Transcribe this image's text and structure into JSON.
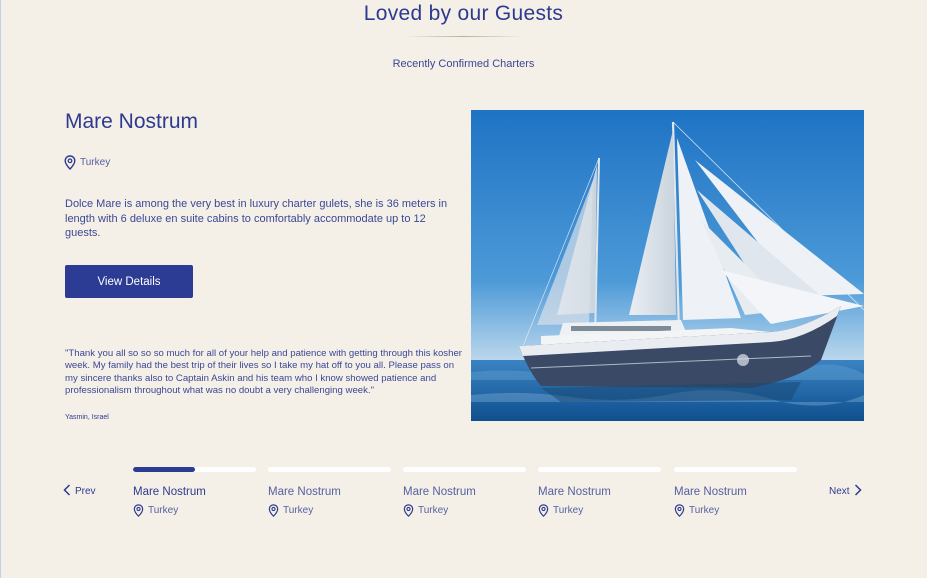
{
  "section": {
    "title": "Loved by our Guests",
    "subtitle": "Recently Confirmed Charters"
  },
  "featured": {
    "name": "Mare Nostrum",
    "location": "Turkey",
    "description": "Dolce Mare is among the very best in luxury charter gulets, she is 36 meters in length with 6 deluxe en suite cabins to comfortably accommodate up to 12 guests.",
    "cta_label": "View Details",
    "quote": "\"Thank you all so so so much for all of your help and patience with getting through this kosher week. My family had the best trip of their lives so I take my hat off to you all. Please pass on my sincere thanks also to Captain Askin and his team who I know showed patience and professionalism throughout what was no doubt a very challenging week.\"",
    "quote_author": "Yasmin, Israel"
  },
  "pager": {
    "prev_label": "Prev",
    "next_label": "Next",
    "active_progress": 0.5,
    "items": [
      {
        "name": "Mare Nostrum",
        "location": "Turkey"
      },
      {
        "name": "Mare Nostrum",
        "location": "Turkey"
      },
      {
        "name": "Mare Nostrum",
        "location": "Turkey"
      },
      {
        "name": "Mare Nostrum",
        "location": "Turkey"
      },
      {
        "name": "Mare Nostrum",
        "location": "Turkey"
      }
    ]
  },
  "colors": {
    "background": "#f4f0e8",
    "accent": "#2c3b93",
    "text": "#2e3a8f"
  },
  "icons": {
    "location": "map-pin-icon",
    "prev": "chevron-left-icon",
    "next": "chevron-right-icon"
  }
}
